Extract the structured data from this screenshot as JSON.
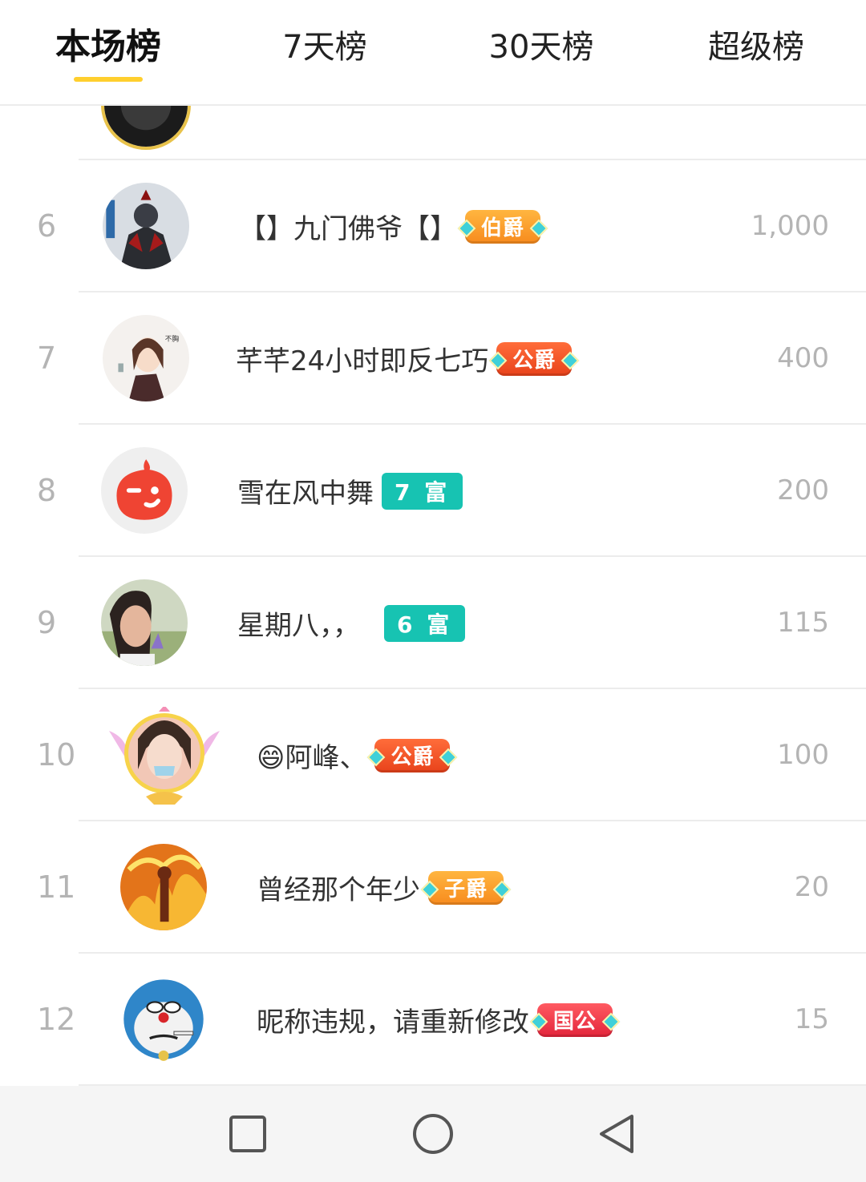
{
  "tabs": [
    {
      "label": "本场榜",
      "active": true
    },
    {
      "label": "7天榜",
      "active": false
    },
    {
      "label": "30天榜",
      "active": false
    },
    {
      "label": "超级榜",
      "active": false
    }
  ],
  "rows": [
    {
      "rank": "6",
      "name": "【】九门佛爷【】",
      "badge": {
        "type": "noble",
        "label": "伯爵",
        "color": "#f78a1d"
      },
      "score": "1,000",
      "avatar": "warrior-avatar"
    },
    {
      "rank": "7",
      "name": "芊芊24小时即反七巧",
      "badge": {
        "type": "noble",
        "label": "公爵",
        "color": "#e8421b"
      },
      "score": "400",
      "avatar": "anime-woman-avatar"
    },
    {
      "rank": "8",
      "name": "雪在风中舞",
      "badge": {
        "type": "fu",
        "label": "7 富",
        "color": "#17c3b2"
      },
      "score": "200",
      "avatar": "default-wink-avatar"
    },
    {
      "rank": "9",
      "name": "星期八，，",
      "badge": {
        "type": "fu",
        "label": "6 富",
        "color": "#17c3b2"
      },
      "score": "115",
      "avatar": "woman-photo-avatar"
    },
    {
      "rank": "10",
      "name": "😄阿峰、",
      "badge": {
        "type": "noble",
        "label": "公爵",
        "color": "#e8421b"
      },
      "score": "100",
      "avatar": "girl-framed-avatar"
    },
    {
      "rank": "11",
      "name": "曾经那个年少",
      "badge": {
        "type": "noble",
        "label": "子爵",
        "color": "#f78a1d"
      },
      "score": "20",
      "avatar": "fire-figure-avatar"
    },
    {
      "rank": "12",
      "name": "昵称违规，请重新修改",
      "badge": {
        "type": "noble",
        "label": "国公",
        "color": "#e3253b"
      },
      "score": "15",
      "avatar": "doraemon-avatar"
    }
  ],
  "navbar": {
    "icons": [
      "recent-apps-icon",
      "home-icon",
      "back-icon"
    ]
  }
}
